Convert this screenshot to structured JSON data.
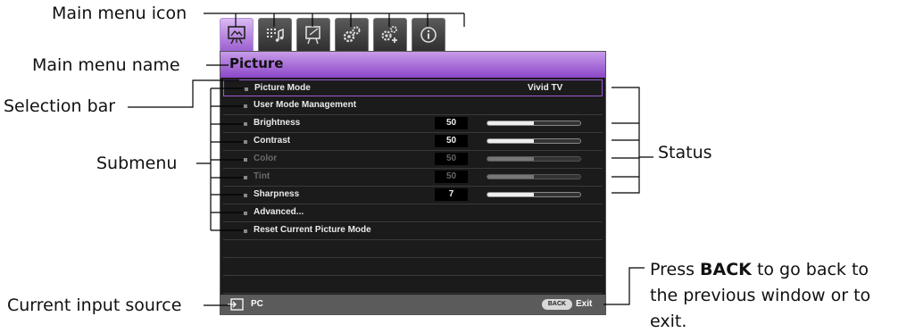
{
  "callouts": {
    "main_menu_icon": "Main menu icon",
    "main_menu_name": "Main menu name",
    "selection_bar": "Selection bar",
    "submenu": "Submenu",
    "status": "Status",
    "current_input_source": "Current input source",
    "back_press": "Press ",
    "back_key": "BACK",
    "back_line1_rest": " to go back to",
    "back_line2": "the previous window or to",
    "back_line3": "exit."
  },
  "osd": {
    "tabs": [
      {
        "icon": "picture-icon",
        "active": true
      },
      {
        "icon": "audio-settings-icon",
        "active": false
      },
      {
        "icon": "display-icon",
        "active": false
      },
      {
        "icon": "system-setup-basic-icon",
        "active": false
      },
      {
        "icon": "system-setup-advanced-icon",
        "active": false
      },
      {
        "icon": "information-icon",
        "active": false
      }
    ],
    "menu_name": "Picture",
    "items": [
      {
        "label": "Picture Mode",
        "mode": "Vivid TV",
        "selected": true
      },
      {
        "label": "User Mode Management"
      },
      {
        "label": "Brightness",
        "value": "50",
        "level": 0.5
      },
      {
        "label": "Contrast",
        "value": "50",
        "level": 0.5
      },
      {
        "label": "Color",
        "value": "50",
        "level": 0.5,
        "disabled": true
      },
      {
        "label": "Tint",
        "value": "50",
        "level": 0.5,
        "disabled": true
      },
      {
        "label": "Sharpness",
        "value": "7",
        "level": 0.5
      },
      {
        "label": "Advanced..."
      },
      {
        "label": "Reset Current Picture Mode"
      }
    ],
    "input_source": "PC",
    "back_button": "BACK",
    "exit_label": "Exit"
  },
  "colors": {
    "accent": "#9b59d8",
    "osd_background": "#1b1b1b",
    "footer": "#5b5b5b"
  }
}
